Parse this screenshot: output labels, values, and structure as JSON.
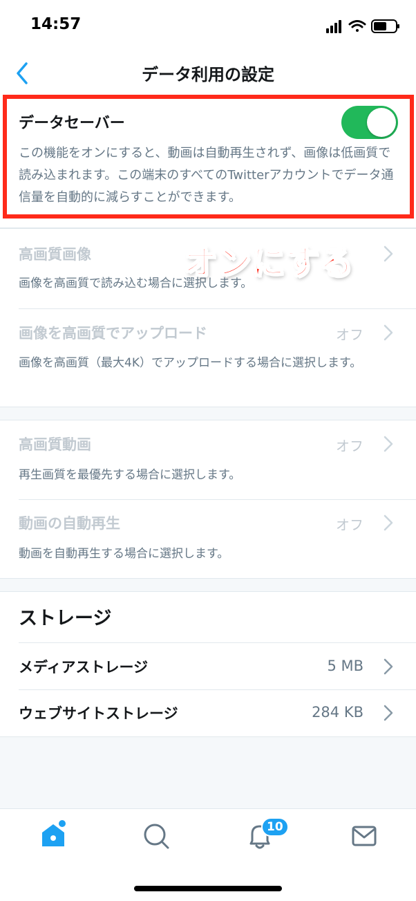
{
  "status_bar": {
    "time": "14:57"
  },
  "nav": {
    "title": "データ利用の設定"
  },
  "data_saver": {
    "label": "データセーバー",
    "enabled": true,
    "description": "この機能をオンにすると、動画は自動再生されず、画像は低画質で読み込まれます。この端末のすべてのTwitterアカウントでデータ通信量を自動的に減らすことができます。"
  },
  "annotation": {
    "text": "オンにする"
  },
  "image_settings": [
    {
      "title": "高画質画像",
      "value": "",
      "description": "画像を高画質で読み込む場合に選択します。"
    },
    {
      "title": "画像を高画質でアップロード",
      "value": "オフ",
      "description": "画像を高画質（最大4K）でアップロードする場合に選択します。"
    }
  ],
  "video_settings": [
    {
      "title": "高画質動画",
      "value": "オフ",
      "description": "再生画質を最優先する場合に選択します。"
    },
    {
      "title": "動画の自動再生",
      "value": "オフ",
      "description": "動画を自動再生する場合に選択します。"
    }
  ],
  "storage": {
    "header": "ストレージ",
    "items": [
      {
        "label": "メディアストレージ",
        "value": "5 MB"
      },
      {
        "label": "ウェブサイトストレージ",
        "value": "284 KB"
      }
    ]
  },
  "tab_bar": {
    "notifications_badge": "10"
  },
  "colors": {
    "accent": "#1da1f2",
    "toggle_on": "#21b85a",
    "highlight": "#ff2a1a"
  }
}
